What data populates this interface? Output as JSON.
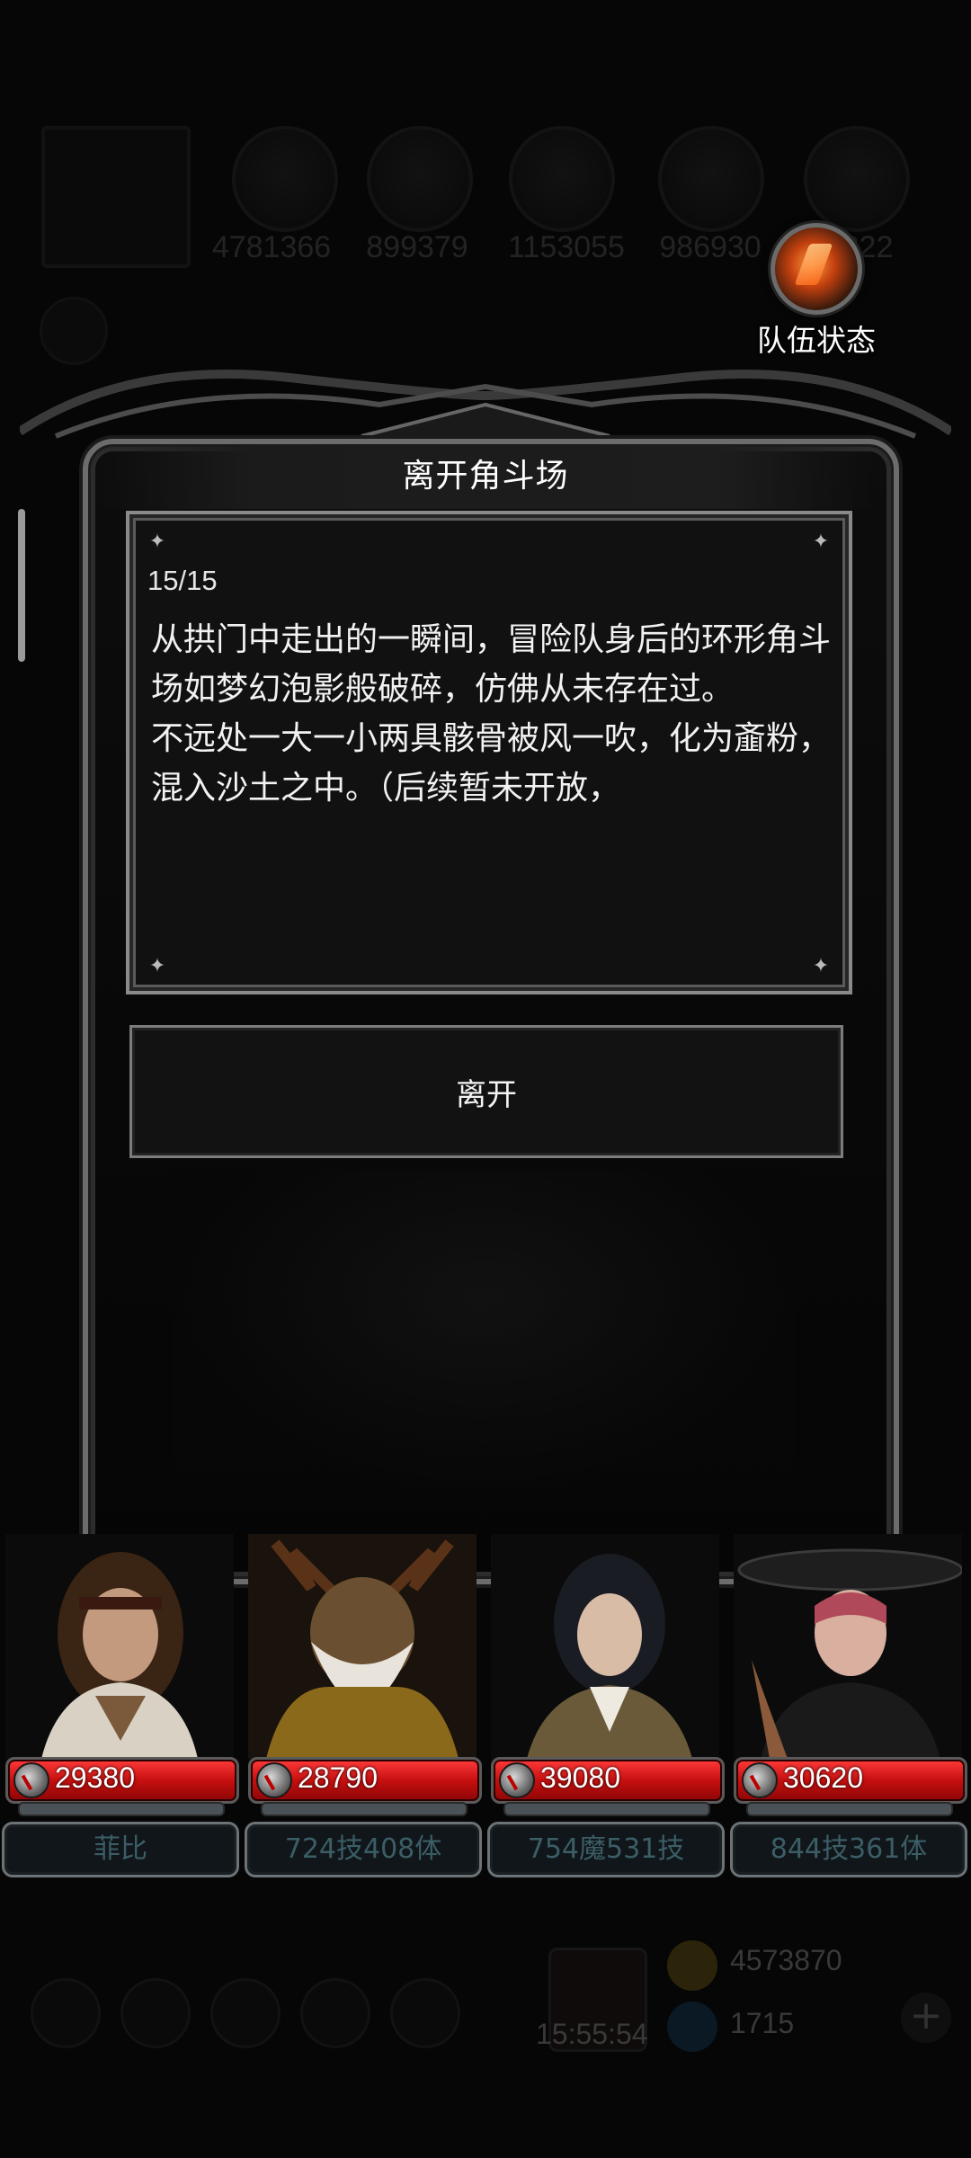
{
  "background": {
    "resources": [
      "4781366",
      "899379",
      "1153055",
      "986930",
      "822"
    ]
  },
  "team_status": {
    "label": "队伍状态"
  },
  "dialog": {
    "title": "离开角斗场",
    "progress": "15/15",
    "story": "从拱门中走出的一瞬间，冒险队身后的环形角斗场如梦幻泡影般破碎，仿佛从未存在过。\n不远处一大一小两具骸骨被风一吹，化为齑粉，混入沙土之中。（后续暂未开放，",
    "leave_button": "离开"
  },
  "team": [
    {
      "hp": "29380",
      "stat": "菲比"
    },
    {
      "hp": "28790",
      "stat": "724技408体"
    },
    {
      "hp": "39080",
      "stat": "754魔531技"
    },
    {
      "hp": "30620",
      "stat": "844技361体"
    }
  ],
  "bottom_bar": {
    "time": "15:55:54",
    "gold": "4573870",
    "gems": "1715"
  },
  "colors": {
    "hp_bar": "#c70f0f",
    "frame": "#6c6c6c",
    "background": "#060606"
  }
}
